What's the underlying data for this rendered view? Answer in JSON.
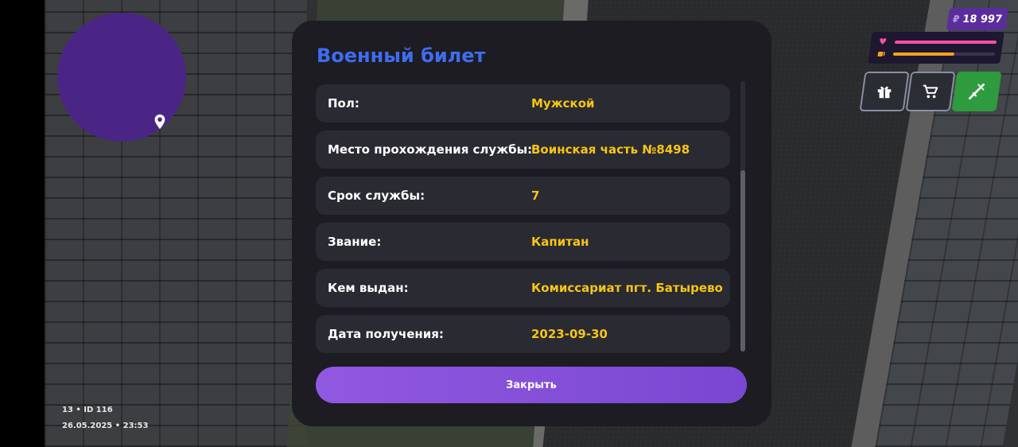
{
  "hud": {
    "money_currency": "₽",
    "money_amount": "18 997",
    "health_level": 1.0,
    "hunger_level": 0.6,
    "health_color": "#ff4fa8",
    "hunger_color": "#f5a21e",
    "icons": [
      "heart-icon",
      "coffee-icon",
      "gift-icon",
      "cart-icon",
      "weapon-icon"
    ],
    "player_line1": "13 • ID 116",
    "player_line2": "26.05.2025 • 23:53"
  },
  "colors": {
    "minimap": "#4b2585",
    "title": "#3f6df0",
    "value": "#f5c518",
    "accent": "#8a52dc"
  },
  "modal": {
    "title": "Военный билет",
    "rows": [
      {
        "label": "Пол:",
        "value": "Мужской"
      },
      {
        "label": "Место прохождения службы:",
        "value": "Воинская часть №8498"
      },
      {
        "label": "Срок службы:",
        "value": "7"
      },
      {
        "label": "Звание:",
        "value": "Капитан"
      },
      {
        "label": "Кем выдан:",
        "value": "Комиссариат пгт. Батырево"
      },
      {
        "label": "Дата получения:",
        "value": "2023-09-30"
      }
    ],
    "close_label": "Закрыть"
  }
}
